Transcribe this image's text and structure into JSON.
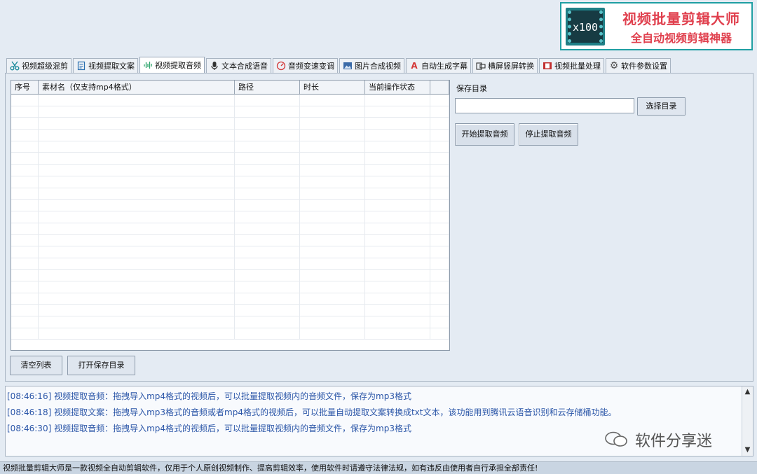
{
  "banner": {
    "logo_text": "x100",
    "title": "视频批量剪辑大师",
    "subtitle": "全自动视频剪辑神器",
    "accent_color": "#e0404e",
    "border_color": "#1f9fa3"
  },
  "tabs": [
    {
      "label": "视频超级混剪",
      "icon": "scissors-icon"
    },
    {
      "label": "视频提取文案",
      "icon": "document-icon"
    },
    {
      "label": "视频提取音频",
      "icon": "audio-wave-icon",
      "active": true
    },
    {
      "label": "文本合成语音",
      "icon": "microphone-icon"
    },
    {
      "label": "音频变速变调",
      "icon": "gauge-icon"
    },
    {
      "label": "图片合成视频",
      "icon": "image-icon"
    },
    {
      "label": "自动生成字幕",
      "icon": "subtitle-icon"
    },
    {
      "label": "横屏竖屏转换",
      "icon": "rotate-screen-icon"
    },
    {
      "label": "视频批量处理",
      "icon": "film-icon"
    },
    {
      "label": "软件参数设置",
      "icon": "gear-icon"
    }
  ],
  "table": {
    "columns": [
      "序号",
      "素材名（仅支持mp4格式）",
      "路径",
      "时长",
      "当前操作状态"
    ],
    "rows": []
  },
  "buttons": {
    "clear_list": "清空列表",
    "open_save_dir": "打开保存目录",
    "choose_dir": "选择目录",
    "start_extract": "开始提取音频",
    "stop_extract": "停止提取音频"
  },
  "save_dir": {
    "label": "保存目录",
    "value": ""
  },
  "log": [
    "[08:46:16] 视频提取音频：拖拽导入mp4格式的视频后，可以批量提取视频内的音频文件，保存为mp3格式",
    "[08:46:18] 视频提取文案：拖拽导入mp3格式的音频或者mp4格式的视频后，可以批量自动提取文案转换成txt文本，该功能用到腾讯云语音识别和云存储桶功能。",
    "[08:46:30] 视频提取音频：拖拽导入mp4格式的视频后，可以批量提取视频内的音频文件，保存为mp3格式"
  ],
  "watermark": "软件分享迷",
  "status_bar": "视频批量剪辑大师是一款视频全自动剪辑软件，仅用于个人原创视频制作、提高剪辑效率，使用软件时请遵守法律法规，如有违反由使用者自行承担全部责任!"
}
